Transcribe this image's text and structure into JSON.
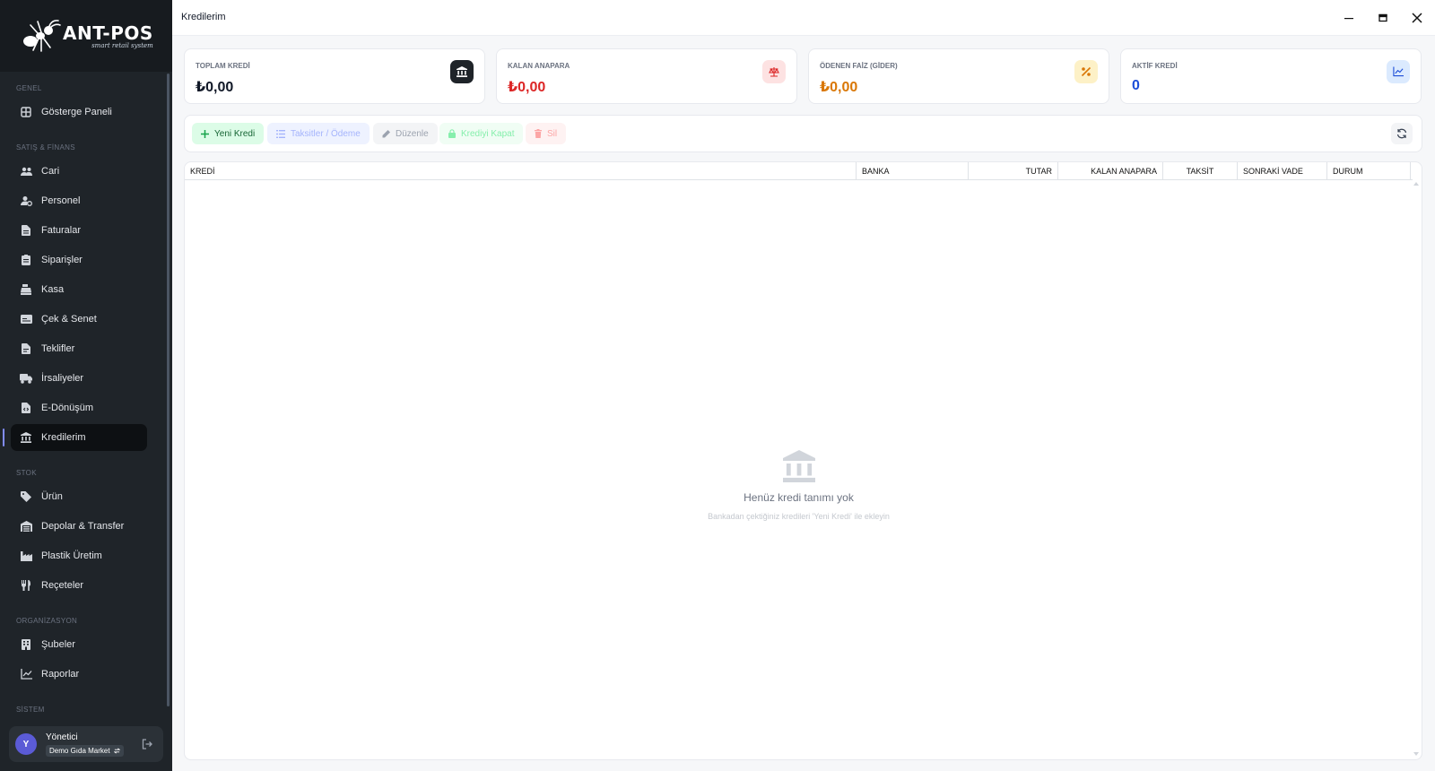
{
  "app": {
    "brand_name": "ANT-POS",
    "brand_tagline": "smart retail system",
    "window_title": "Kredilerim"
  },
  "sidebar": {
    "sections": {
      "genel": "GENEL",
      "satis": "SATIŞ & FİNANS",
      "stok": "STOK",
      "organizasyon": "ORGANİZASYON",
      "sistem": "SİSTEM"
    },
    "items": {
      "gosterge": "Gösterge Paneli",
      "cari": "Cari",
      "personel": "Personel",
      "faturalar": "Faturalar",
      "siparisler": "Siparişler",
      "kasa": "Kasa",
      "cek": "Çek & Senet",
      "teklifler": "Teklifler",
      "irsaliyeler": "İrsaliyeler",
      "edonusum": "E-Dönüşüm",
      "kredilerim": "Kredilerim",
      "urun": "Ürün",
      "depolar": "Depolar & Transfer",
      "plastik": "Plastik Üretim",
      "receteler": "Reçeteler",
      "subeler": "Şubeler",
      "raporlar": "Raporlar"
    },
    "active_item": "kredilerim",
    "user": {
      "initial": "Y",
      "name": "Yönetici",
      "shop": "Demo Gıda Market"
    }
  },
  "stats": {
    "toplam": {
      "label": "TOPLAM KREDİ",
      "value": "₺0,00",
      "color": "#111827",
      "icon_bg": "#1f2429",
      "icon": "bank-icon"
    },
    "kalan": {
      "label": "KALAN ANAPARA",
      "value": "₺0,00",
      "color": "#dc2626",
      "icon_bg": "#fde2e2",
      "icon": "scale-icon"
    },
    "faiz": {
      "label": "ÖDENEN FAİZ (GİDER)",
      "value": "₺0,00",
      "color": "#d97706",
      "icon_bg": "#fdf1c7",
      "icon": "percent-icon"
    },
    "aktif": {
      "label": "AKTİF KREDİ",
      "value": "0",
      "color": "#1d4ed8",
      "icon_bg": "#dbeafe",
      "icon": "chart-line-icon"
    }
  },
  "toolbar": {
    "yeni_kredi": "Yeni Kredi",
    "taksitler": "Taksitler / Ödeme",
    "duzenle": "Düzenle",
    "krediyi_kapat": "Krediyi Kapat",
    "sil": "Sil"
  },
  "table": {
    "columns": {
      "kredi": "KREDİ",
      "banka": "BANKA",
      "tutar": "TUTAR",
      "kalan": "KALAN ANAPARA",
      "taksit": "TAKSİT",
      "vade": "SONRAKİ VADE",
      "durum": "DURUM"
    },
    "empty_title": "Henüz kredi tanımı yok",
    "empty_subtitle": "Bankadan çektiğiniz kredileri 'Yeni Kredi' ile ekleyin"
  }
}
